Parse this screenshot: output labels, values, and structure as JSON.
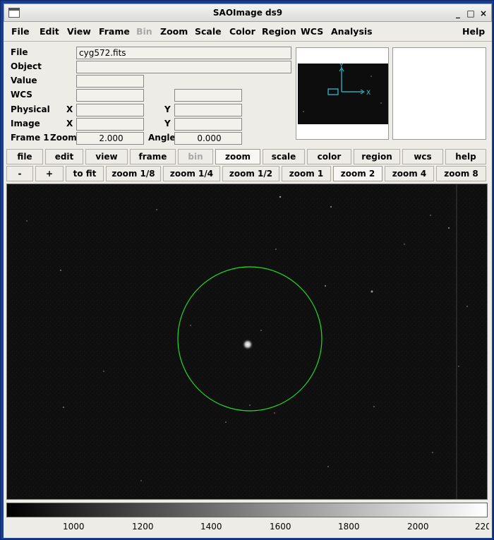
{
  "window": {
    "title": "SAOImage ds9",
    "controls": [
      "_",
      "□",
      "×"
    ]
  },
  "menu": {
    "items": [
      {
        "label": "File",
        "enabled": true
      },
      {
        "label": "Edit",
        "enabled": true
      },
      {
        "label": "View",
        "enabled": true
      },
      {
        "label": "Frame",
        "enabled": true
      },
      {
        "label": "Bin",
        "enabled": false
      },
      {
        "label": "Zoom",
        "enabled": true
      },
      {
        "label": "Scale",
        "enabled": true
      },
      {
        "label": "Color",
        "enabled": true
      },
      {
        "label": "Region",
        "enabled": true
      },
      {
        "label": "WCS",
        "enabled": true
      },
      {
        "label": "Analysis",
        "enabled": true
      },
      {
        "label": "Help",
        "enabled": true
      }
    ]
  },
  "info": {
    "file_label": "File",
    "file_value": "cyg572.fits",
    "object_label": "Object",
    "object_value": "",
    "value_label": "Value",
    "value_value": "",
    "wcs_label": "WCS",
    "wcs_value": "",
    "wcs_value2": "",
    "physical_label": "Physical",
    "physical_x_label": "X",
    "physical_y_label": "Y",
    "physical_x": "",
    "physical_y": "",
    "image_label": "Image",
    "image_x_label": "X",
    "image_y_label": "Y",
    "image_x": "",
    "image_y": "",
    "frame_label": "Frame 1",
    "zoom_label": "Zoom",
    "zoom_value": "2.000",
    "angle_label": "Angle",
    "angle_value": "0.000"
  },
  "panner": {
    "y_axis_label": "Y",
    "x_axis_label": "X"
  },
  "buttonbar": {
    "items": [
      {
        "label": "file",
        "active": false,
        "enabled": true
      },
      {
        "label": "edit",
        "active": false,
        "enabled": true
      },
      {
        "label": "view",
        "active": false,
        "enabled": true
      },
      {
        "label": "frame",
        "active": false,
        "enabled": true
      },
      {
        "label": "bin",
        "active": false,
        "enabled": false
      },
      {
        "label": "zoom",
        "active": true,
        "enabled": true
      },
      {
        "label": "scale",
        "active": false,
        "enabled": true
      },
      {
        "label": "color",
        "active": false,
        "enabled": true
      },
      {
        "label": "region",
        "active": false,
        "enabled": true
      },
      {
        "label": "wcs",
        "active": false,
        "enabled": true
      },
      {
        "label": "help",
        "active": false,
        "enabled": true
      }
    ]
  },
  "zoombar": {
    "items": [
      {
        "label": "-",
        "active": false
      },
      {
        "label": "+",
        "active": false
      },
      {
        "label": "to fit",
        "active": false
      },
      {
        "label": "zoom 1/8",
        "active": false
      },
      {
        "label": "zoom 1/4",
        "active": false
      },
      {
        "label": "zoom 1/2",
        "active": false
      },
      {
        "label": "zoom 1",
        "active": false
      },
      {
        "label": "zoom 2",
        "active": true
      },
      {
        "label": "zoom 4",
        "active": false
      },
      {
        "label": "zoom 8",
        "active": false
      }
    ]
  },
  "image": {
    "region_shape": "circle",
    "region_color": "#22dd22",
    "background": "#0d0d0d"
  },
  "colorbar": {
    "ticks": [
      "1000",
      "1200",
      "1400",
      "1600",
      "1800",
      "2000",
      "220"
    ]
  }
}
